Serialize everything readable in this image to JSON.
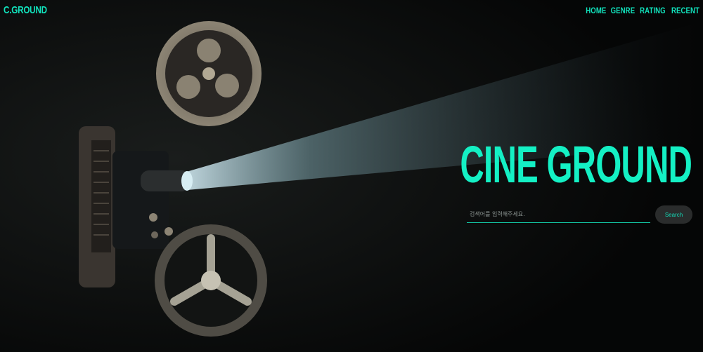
{
  "header": {
    "logo": "C.GROUND",
    "nav": [
      "HOME",
      "GENRE",
      "RATING",
      "RECENT"
    ]
  },
  "hero": {
    "title": "CINE GROUND",
    "image": "film-projector-beam"
  },
  "search": {
    "placeholder": "검색어를 입력해주세요.",
    "value": "",
    "button_label": "Search"
  },
  "colors": {
    "accent": "#14f0c4",
    "background": "#060707",
    "button_bg": "#2a2c2c"
  }
}
